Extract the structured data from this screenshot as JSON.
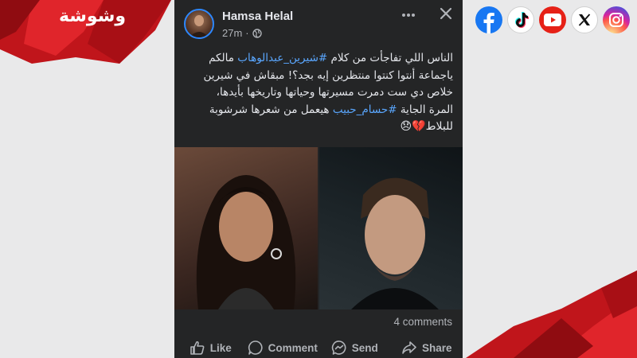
{
  "brand": {
    "logo_text": "وشوشة",
    "accent_color": "#d71920"
  },
  "post": {
    "author": "Hamsa Helal",
    "time": "27m",
    "privacy_icon": "globe-icon",
    "text_lines": [
      {
        "before": "الناس اللي تفاجأت من كلام ",
        "tag": "#شيرين_عبدالوهاب",
        "after": " مالكم"
      },
      {
        "before": "ياجماعة أنتوا كنتوا منتظرين إيه بجد؟! مبقاش في شيرين",
        "tag": "",
        "after": ""
      },
      {
        "before": "خلاص دي ست دمرت مسيرتها وحياتها وتاريخها بأيدها،",
        "tag": "",
        "after": ""
      },
      {
        "before": "المرة الجاية ",
        "tag": "#حسام_حبيب",
        "after": " هيعمل من شعرها شرشوبة"
      },
      {
        "before": "للبلاط💔😞",
        "tag": "",
        "after": ""
      }
    ],
    "comments_count": "4 comments",
    "actions": {
      "like": "Like",
      "comment": "Comment",
      "send": "Send",
      "share": "Share"
    }
  },
  "socials": [
    "facebook-icon",
    "tiktok-icon",
    "youtube-icon",
    "x-icon",
    "instagram-icon"
  ]
}
